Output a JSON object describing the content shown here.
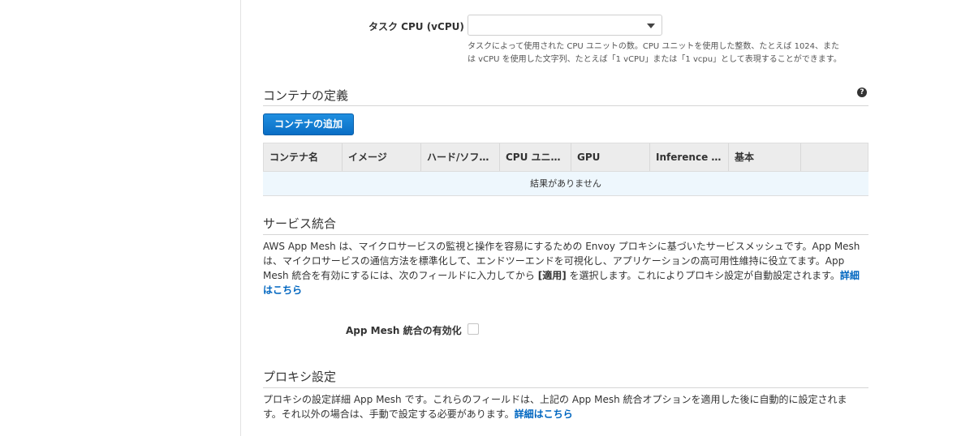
{
  "cpu": {
    "label": "タスク CPU (vCPU)",
    "selected_value": "",
    "help_line1": "タスクによって使用された CPU ユニットの数。CPU ユニットを使用した整数、たとえば 1024、また",
    "help_line2": "は vCPU を使用した文字列、たとえば「1 vCPU」または「1 vcpu」として表現することができます。"
  },
  "container_section": {
    "title": "コンテナの定義",
    "help_icon": "?",
    "add_button": "コンテナの追加",
    "columns": [
      "コンテナ名",
      "イメージ",
      "ハード/ソフ…",
      "CPU ユニ…",
      "GPU",
      "Inference …",
      "基本",
      ""
    ],
    "empty_message": "結果がありません"
  },
  "service_section": {
    "title": "サービス統合",
    "desc_line1": "AWS App Mesh は、マイクロサービスの監視と操作を容易にするための Envoy プロキシに基づいたサービスメッシュです。App Mesh",
    "desc_line2": "は、マイクロサービスの通信方法を標準化して、エンドツーエンドを可視化し、アプリケーションの高可用性維持に役立てます。App",
    "desc_line3a": "Mesh 統合を有効にするには、次のフィールドに入力してから ",
    "desc_line3_bracket": "[適用]",
    "desc_line3b": " を選択します。これによりプロキシ設定が自動設定されます。",
    "link_part1": "詳細",
    "link_part2": "はこちら",
    "enable_label": "App Mesh 統合の有効化",
    "enable_checked": false
  },
  "proxy_section": {
    "title": "プロキシ設定",
    "desc_line1": "プロキシの設定詳細 App Mesh です。これらのフィールドは、上記の App Mesh 統合オプションを適用した後に自動的に設定されま",
    "desc_line2": "す。それ以外の場合は、手動で設定する必要があります。",
    "link": "詳細はこちら"
  }
}
